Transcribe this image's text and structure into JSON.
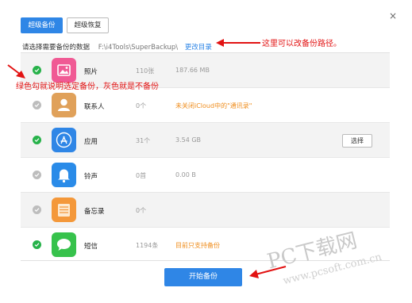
{
  "tabs": {
    "backup": "超级备份",
    "restore": "超级恢复"
  },
  "close_icon": "×",
  "path_section": {
    "label": "请选择需要备份的数据",
    "path": "F:\\i4Tools\\SuperBackup\\",
    "change_link": "更改目录"
  },
  "items": [
    {
      "name": "照片",
      "count": "110张",
      "size": "187.66 MB",
      "note": "",
      "checked": true,
      "icon": "photos-icon",
      "color": "#f05a94"
    },
    {
      "name": "联系人",
      "count": "0个",
      "size": "",
      "note": "未关闭iCloud中的\"通讯录\"",
      "checked": false,
      "icon": "contacts-icon",
      "color": "#e0a15a"
    },
    {
      "name": "应用",
      "count": "31个",
      "size": "3.54 GB",
      "note": "",
      "checked": true,
      "icon": "app-store-icon",
      "color": "#2f86e6",
      "action": "选择"
    },
    {
      "name": "铃声",
      "count": "0首",
      "size": "0.00 B",
      "note": "",
      "checked": false,
      "icon": "bell-icon",
      "color": "#2a8be8"
    },
    {
      "name": "备忘录",
      "count": "0个",
      "size": "",
      "note": "",
      "checked": false,
      "icon": "notes-icon",
      "color": "#f4983a"
    },
    {
      "name": "短信",
      "count": "1194条",
      "size": "",
      "note": "目前只支持备份",
      "checked": true,
      "icon": "messages-icon",
      "color": "#37c24c"
    }
  ],
  "start_button": "开始备份",
  "annotations": {
    "path_note": "这里可以改备份路径。",
    "check_note": "绿色勾就说明选定备份，灰色就是不备份"
  },
  "watermark": {
    "brand": "PC下载网",
    "url": "www.pcsoft.com.cn"
  },
  "colors": {
    "accent": "#2f86e6",
    "checked": "#27b24a",
    "unchecked": "#bdbdbd",
    "warning": "#ef8c1b",
    "annotation": "#e21212"
  }
}
